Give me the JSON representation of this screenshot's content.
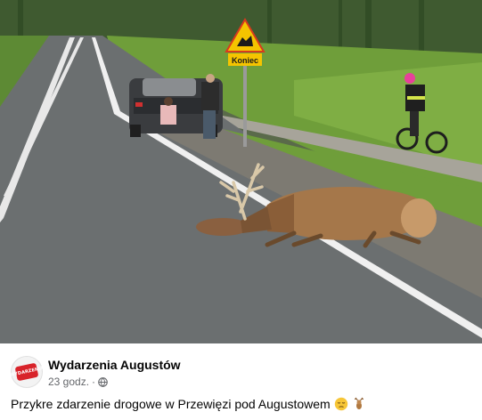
{
  "post": {
    "author": "Wydarzenia Augustów",
    "avatar_text": "WYDARZENIA",
    "timestamp": "23 godz.",
    "separator": "·",
    "privacy_icon": "globe-icon",
    "caption": "Przykre zdarzenie drogowe w Przewięzi pod Augustowem",
    "emojis": [
      "pensive-face-icon",
      "deer-icon"
    ]
  },
  "photo": {
    "sign_text": "Koniec",
    "colors": {
      "sign_yellow": "#f5c400",
      "road": "#6b6f70",
      "grass": "#6f9e3a",
      "deer": "#a5774a"
    }
  }
}
